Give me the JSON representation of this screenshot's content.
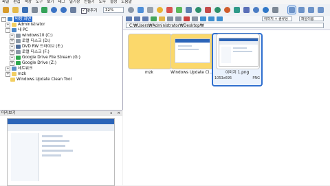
{
  "menu": [
    "파일",
    "편집",
    "색상",
    "도구",
    "보기",
    "태그",
    "일기장",
    "만들기",
    "도우",
    "설정",
    "도움말"
  ],
  "toolbar": {
    "fit_label": "맞추기",
    "zoom": "32%"
  },
  "tree": {
    "items": [
      {
        "label": "Administrator",
        "icon": "folder-icon"
      },
      {
        "label": "내 PC",
        "icon": "pc-icon"
      },
      {
        "label": "windows10 (C:)",
        "icon": "drive-icon"
      },
      {
        "label": "로컬 디스크 (D:)",
        "icon": "drive-icon"
      },
      {
        "label": "DVD RW 드라이브 (E:)",
        "icon": "dvd-icon"
      },
      {
        "label": "로컬 디스크 (F:)",
        "icon": "drive-icon"
      },
      {
        "label": "Google Drive File Stream (G:)",
        "icon": "gdrive-icon"
      },
      {
        "label": "Google Drive (Z:)",
        "icon": "gdrive-icon"
      },
      {
        "label": "네트워크",
        "icon": "network-icon"
      },
      {
        "label": "mzk",
        "icon": "folder-icon"
      },
      {
        "label": "Windows Update Clean Tool",
        "icon": "folder-icon"
      }
    ],
    "selected_label": "바탕 화면"
  },
  "preview": {
    "title": "미리보기"
  },
  "path": {
    "value": "C:₩Users₩Administrator₩Desktop₩"
  },
  "sort": {
    "name_label": "이미지 + 종류상",
    "view_label": "파일이름"
  },
  "files": [
    {
      "name": "mzk",
      "type": "folder"
    },
    {
      "name": "Windows Update Cl...",
      "type": "folder"
    },
    {
      "name": "이미지 1.png",
      "type": "image",
      "dims": "1053x695",
      "format": "PNG"
    }
  ]
}
